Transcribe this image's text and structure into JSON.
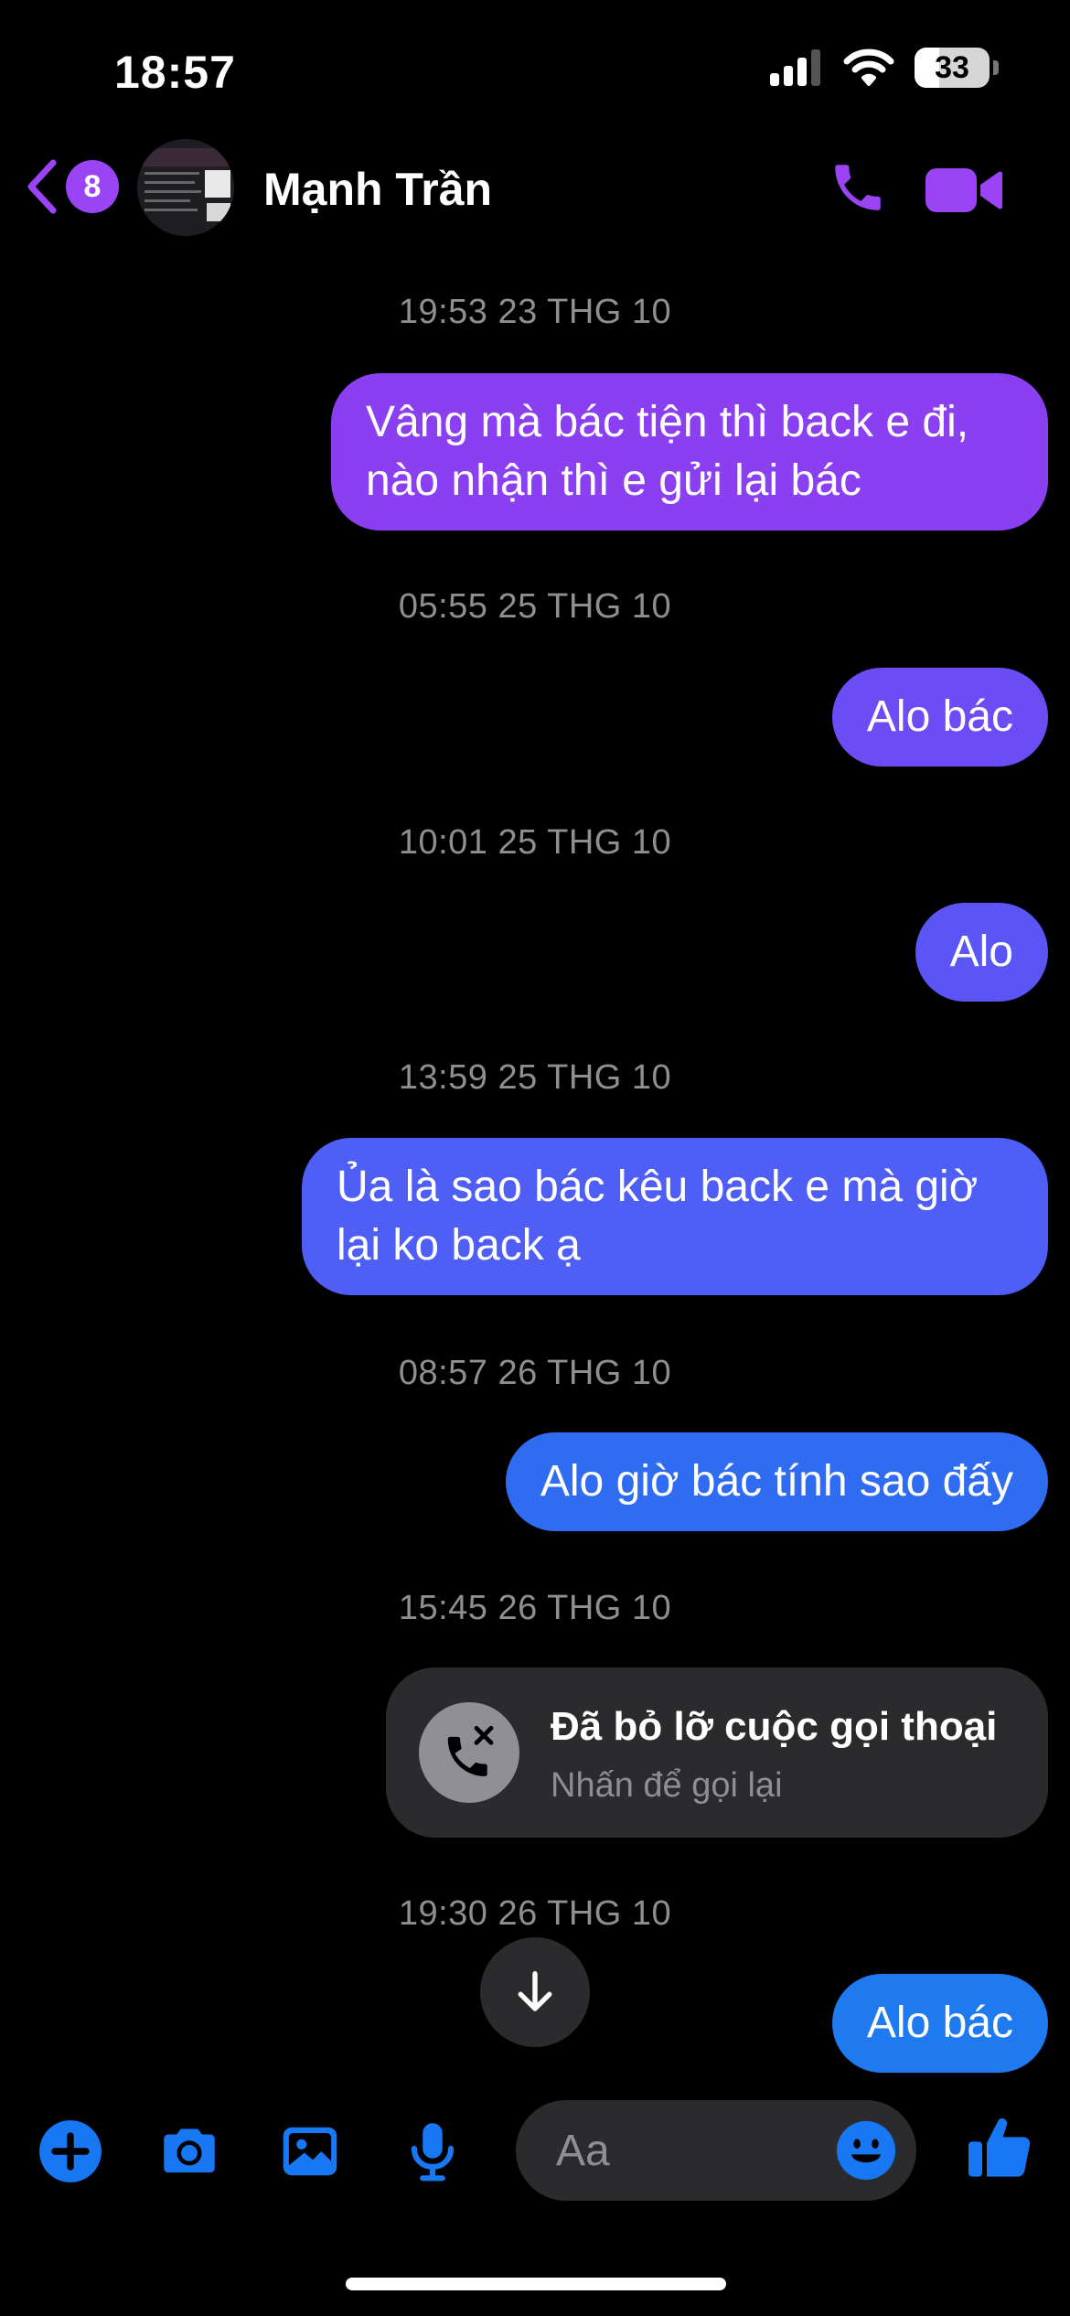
{
  "status_bar": {
    "time": "18:57",
    "battery": "33",
    "battery_level": 0.33
  },
  "header": {
    "unread_count": "8",
    "contact_name": "Mạnh Trần"
  },
  "messages": [
    {
      "timestamp": "19:53 23 THG 10",
      "text": "Vâng mà bác tiện thì back e đi, nào nhận thì e gửi lại bác",
      "color": "#8a3ff0"
    },
    {
      "timestamp": "05:55 25 THG 10",
      "text": "Alo bác",
      "color": "#6b4cf5"
    },
    {
      "timestamp": "10:01 25 THG 10",
      "text": "Alo",
      "color": "#5b55f6"
    },
    {
      "timestamp": "13:59 25 THG 10",
      "text": "Ủa là sao bác kêu back e mà giờ lại ko back ạ",
      "color": "#4f5ff5"
    },
    {
      "timestamp": "08:57 26 THG 10",
      "text": "Alo giờ bác tính sao đấy",
      "color": "#2f6cf2"
    },
    {
      "timestamp": "15:45 26 THG 10",
      "missed_call": {
        "title": "Đã bỏ lỡ cuộc gọi thoại",
        "subtitle": "Nhấn để gọi lại"
      }
    },
    {
      "timestamp": "19:30 26 THG 10",
      "text": "Alo bác",
      "color": "#1f7af0"
    }
  ],
  "composer": {
    "placeholder": "Aa"
  },
  "colors": {
    "accent_purple": "#9b44f5",
    "accent_blue": "#1877f2"
  },
  "icons": [
    "back-chevron-icon",
    "phone-icon",
    "video-camera-icon",
    "missed-call-icon",
    "arrow-down-icon",
    "plus-icon",
    "camera-icon",
    "image-icon",
    "microphone-icon",
    "emoji-icon",
    "thumbs-up-icon"
  ]
}
